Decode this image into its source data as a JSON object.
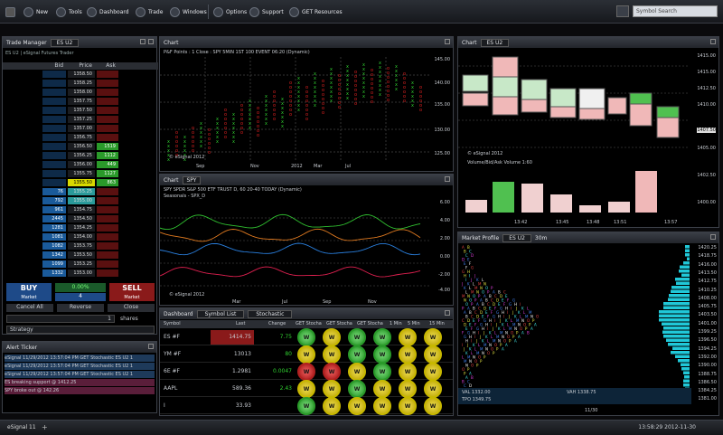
{
  "toolbar": {
    "items": [
      "New",
      "Tools",
      "Dashboard",
      "Trade",
      "Windows",
      "Options",
      "Support",
      "GET Resources"
    ],
    "search_placeholder": "Symbol Search"
  },
  "trade_manager": {
    "title": "Trade Manager",
    "symbol": "ES U2",
    "subtitle": "ES U2 | eSignal Futures Trader",
    "headers": [
      "Bid",
      "Price",
      "Ask"
    ],
    "rows": [
      {
        "bid": "",
        "price": "1358.50",
        "ask": ""
      },
      {
        "bid": "",
        "price": "1358.25",
        "ask": ""
      },
      {
        "bid": "",
        "price": "1358.00",
        "ask": ""
      },
      {
        "bid": "",
        "price": "1357.75",
        "ask": ""
      },
      {
        "bid": "",
        "price": "1357.50",
        "ask": ""
      },
      {
        "bid": "",
        "price": "1357.25",
        "ask": ""
      },
      {
        "bid": "",
        "price": "1357.00",
        "ask": ""
      },
      {
        "bid": "",
        "price": "1356.75",
        "ask": ""
      },
      {
        "bid": "",
        "price": "1356.50",
        "ask": "1519"
      },
      {
        "bid": "",
        "price": "1356.25",
        "ask": "1112"
      },
      {
        "bid": "",
        "price": "1356.00",
        "ask": "449"
      },
      {
        "bid": "",
        "price": "1355.75",
        "ask": "1127"
      },
      {
        "bid": "",
        "price": "1355.50",
        "ask": "863"
      },
      {
        "bid": "76",
        "price": "1355.25",
        "ask": ""
      },
      {
        "bid": "792",
        "price": "1355.00",
        "ask": ""
      },
      {
        "bid": "961",
        "price": "1354.75",
        "ask": ""
      },
      {
        "bid": "2445",
        "price": "1354.50",
        "ask": ""
      },
      {
        "bid": "1281",
        "price": "1354.25",
        "ask": ""
      },
      {
        "bid": "1081",
        "price": "1354.00",
        "ask": ""
      },
      {
        "bid": "1082",
        "price": "1353.75",
        "ask": ""
      },
      {
        "bid": "1342",
        "price": "1353.50",
        "ask": ""
      },
      {
        "bid": "1099",
        "price": "1353.25",
        "ask": ""
      },
      {
        "bid": "1332",
        "price": "1353.00",
        "ask": ""
      }
    ],
    "buy": "BUY",
    "buy_sub": "Market",
    "sell": "SELL",
    "sell_sub": "Market",
    "pl": "0.00%",
    "qty": "4",
    "cancel_all": "Cancel All",
    "reverse": "Reverse",
    "close": "Close",
    "qty_value": "1",
    "shares": "shares",
    "strategy": "Strategy"
  },
  "alert": {
    "title": "Alert Ticker",
    "lines": [
      "eSignal 11/29/2012 13:57:04 PM GET Stochastic ES U2 1",
      "eSignal 11/29/2012 13:57:04 PM GET Stochastic ES U2 1",
      "eSignal 11/29/2012 13:57:04 PM GET Stochastic ES U2 1",
      "ES breaking support @ 1412.25",
      "SPY broke out @ 142.26"
    ]
  },
  "chart1": {
    "title": "Chart",
    "subtitle": "P&F Points : 1 Close : SPY 5MIN 1ST 100 EVENT 06:20 (Dynamic)",
    "x_labels": [
      "Sep",
      "Nov",
      "2012",
      "Mar",
      "Jul"
    ],
    "y_labels": [
      "145.00",
      "140.00",
      "135.00",
      "130.00",
      "125.00"
    ],
    "footer": "© eSignal 2012"
  },
  "chart2": {
    "title": "Chart",
    "symbol": "SPY",
    "subtitle": "SPY SPDR S&P 500 ETF TRUST D, 60 20-40 TODAY (Dynamic)",
    "sub2": "Seasonals - SPX_D",
    "x_labels": [
      "Mar",
      "Jul",
      "Sep",
      "Nov"
    ],
    "y_labels": [
      "6.00",
      "4.00",
      "2.00",
      "0.00",
      "-2.00",
      "-4.00"
    ],
    "footer": "© eSignal 2012"
  },
  "chart3": {
    "title": "Chart",
    "symbol": "ES U2",
    "y_labels": [
      "1415.00",
      "1415.00",
      "1412.50",
      "1410.00",
      "1407.50",
      "1405.00",
      "1402.50",
      "1400.00"
    ],
    "x_labels": [
      "13:42",
      "13:45",
      "13:48",
      "13:51",
      "13:57"
    ],
    "footer": "© eSignal 2012",
    "vol_title": "Volume/Bid/Ask Volume 1:60",
    "vol_values": [
      "1,350,622",
      "1,200,000",
      "1,000,000"
    ]
  },
  "market_profile": {
    "title": "Market Profile",
    "symbol": "ES U2",
    "sub": "30m",
    "y_labels": [
      "1420.25",
      "1418.75",
      "1416.00",
      "1413.50",
      "1412.75",
      "1410.25",
      "1408.00",
      "1405.75",
      "1403.50",
      "1401.00",
      "1399.25",
      "1396.50",
      "1394.25",
      "1392.00",
      "1390.00",
      "1388.75",
      "1386.50",
      "1384.25",
      "1381.00"
    ],
    "val": "VAL 1332.00",
    "vah": "VAH 1338.75",
    "tpo": "TPO 1349.75",
    "time": "11/30"
  },
  "dashboard": {
    "title": "Dashboard",
    "list": "Symbol List",
    "study": "Stochastic",
    "headers": [
      "Symbol",
      "Last",
      "Change",
      "GET Stocha",
      "GET Stocha",
      "GET Stocha",
      "1 Min",
      "5 Min",
      "15 Min"
    ],
    "rows": [
      {
        "sym": "ES #F",
        "last": "1414.75",
        "chg": "7.75",
        "g": [
          "g",
          "y",
          "g",
          "g",
          "y",
          "y"
        ]
      },
      {
        "sym": "YM #F",
        "last": "13013",
        "chg": "80",
        "g": [
          "y",
          "y",
          "g",
          "g",
          "y",
          "y"
        ]
      },
      {
        "sym": "6E #F",
        "last": "1.2981",
        "chg": "0.0047",
        "g": [
          "r",
          "r",
          "y",
          "g",
          "y",
          "y"
        ]
      },
      {
        "sym": "AAPL",
        "last": "589.36",
        "chg": "2.43",
        "g": [
          "y",
          "y",
          "g",
          "y",
          "y",
          "y"
        ]
      },
      {
        "sym": "I",
        "last": "33.93",
        "chg": "",
        "g": [
          "g",
          "y",
          "y",
          "y",
          "y",
          "y"
        ]
      }
    ],
    "gauge_label": "W"
  },
  "statusbar": {
    "left": "eSignal 11",
    "right": "13:58:29 2012-11-30"
  },
  "colors": {
    "bid": "#1a5a9a",
    "ask": "#8a1a1a",
    "green": "#2bd02b",
    "red": "#e02020"
  }
}
